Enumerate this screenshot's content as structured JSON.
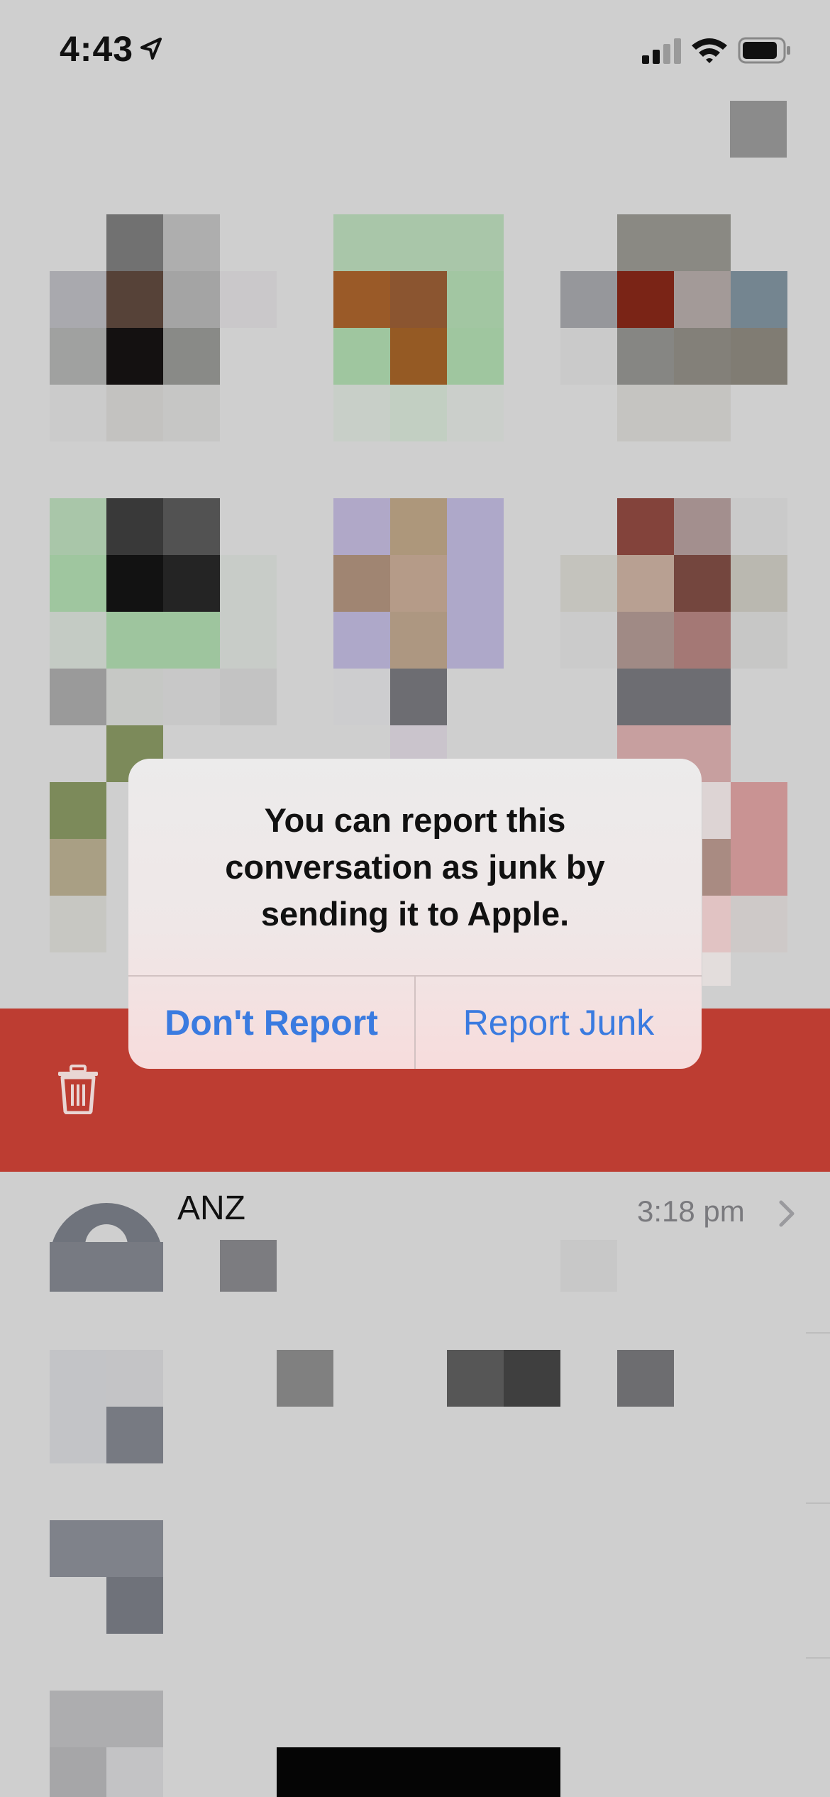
{
  "status_bar": {
    "time": "4:43",
    "icons": [
      "location-arrow-icon",
      "cellular-signal-icon",
      "wifi-icon",
      "battery-icon"
    ]
  },
  "alert": {
    "message": "You can report this conversation as junk by sending it to Apple.",
    "dont_report_label": "Don't Report",
    "report_junk_label": "Report Junk"
  },
  "swipe_action": {
    "icon": "trash-icon",
    "color": "#bd3d32"
  },
  "conversation": {
    "sender": "ANZ",
    "time": "3:18 pm",
    "chevron_icon": "chevron-right-icon"
  },
  "colors": {
    "background": "#cfcfcf",
    "accent": "#3a7be0"
  }
}
